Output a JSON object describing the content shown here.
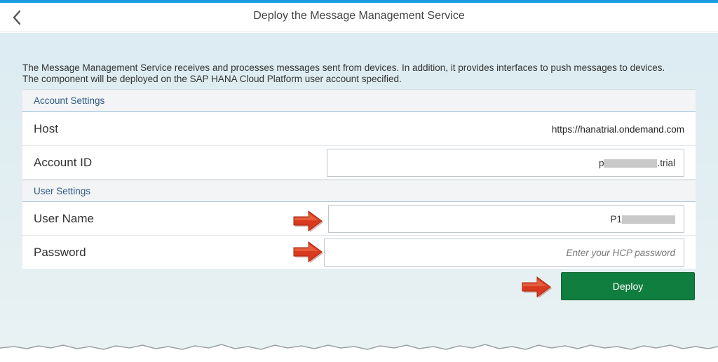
{
  "header": {
    "title": "Deploy the Message Management Service"
  },
  "description": "The Message Management Service receives and processes messages sent from devices. In addition, it provides interfaces to push messages to devices. The component will be deployed on the SAP HANA Cloud Platform user account specified.",
  "account_settings": {
    "section_title": "Account Settings",
    "host_label": "Host",
    "host_value": "https://hanatrial.ondemand.com",
    "account_id_label": "Account ID",
    "account_id_prefix": "p",
    "account_id_suffix": ".trial"
  },
  "user_settings": {
    "section_title": "User Settings",
    "user_name_label": "User Name",
    "user_name_prefix": "P1",
    "password_label": "Password",
    "password_placeholder": "Enter your HCP password"
  },
  "actions": {
    "deploy_label": "Deploy"
  },
  "icons": {
    "back": "chevron-left-icon",
    "annotation": "red-arrow-icon"
  },
  "colors": {
    "accent": "#1a9ce0",
    "deploy": "#107e3e",
    "section_text": "#2f5a86",
    "arrow": "#d93a1f"
  }
}
